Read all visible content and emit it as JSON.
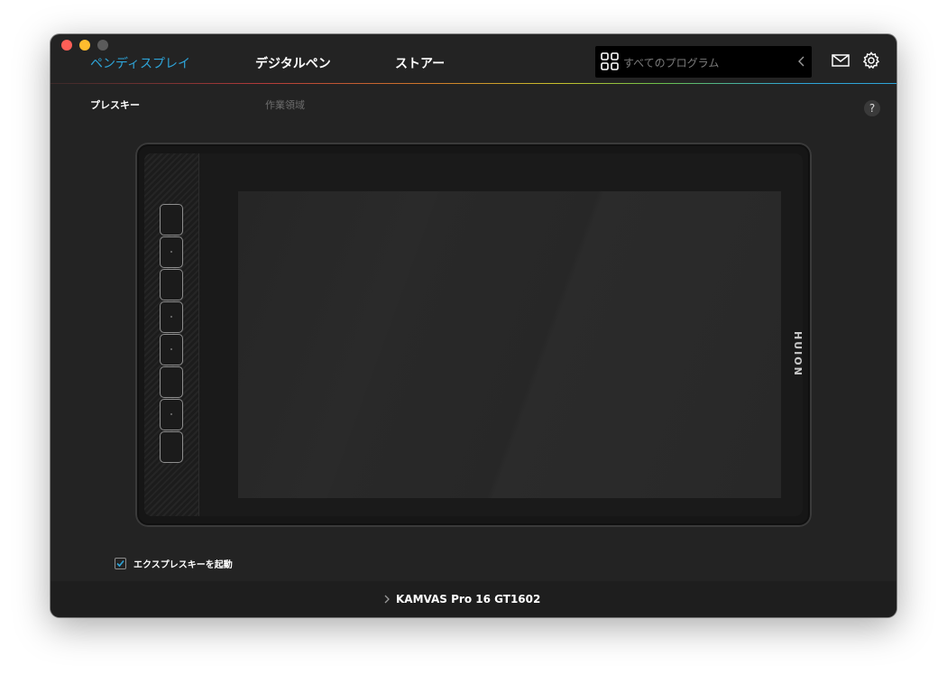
{
  "window": {
    "traffic_lights": [
      "close",
      "minimize",
      "zoom"
    ],
    "colors": {
      "close": "#fe5f57",
      "minimize": "#febc2e",
      "zoom": "#5b5b5b"
    }
  },
  "topnav": {
    "tabs": [
      {
        "label": "ペンディスプレイ",
        "active": true
      },
      {
        "label": "デジタルペン",
        "active": false
      },
      {
        "label": "ストアー",
        "active": false
      }
    ],
    "program_select": {
      "label": "すべてのプログラム",
      "icon": "grid-icon"
    },
    "icons": [
      "mail-icon",
      "gear-icon"
    ],
    "accent": "#2ea4d8"
  },
  "subtabs": [
    {
      "label": "プレスキー",
      "active": true
    },
    {
      "label": "作業領域",
      "active": false
    }
  ],
  "help": {
    "label": "?"
  },
  "tablet": {
    "brand": "HUION",
    "express_keys_count": 8
  },
  "checkbox": {
    "label": "エクスプレスキーを起動",
    "checked": true
  },
  "footer": {
    "device": "KAMVAS Pro 16 GT1602"
  }
}
